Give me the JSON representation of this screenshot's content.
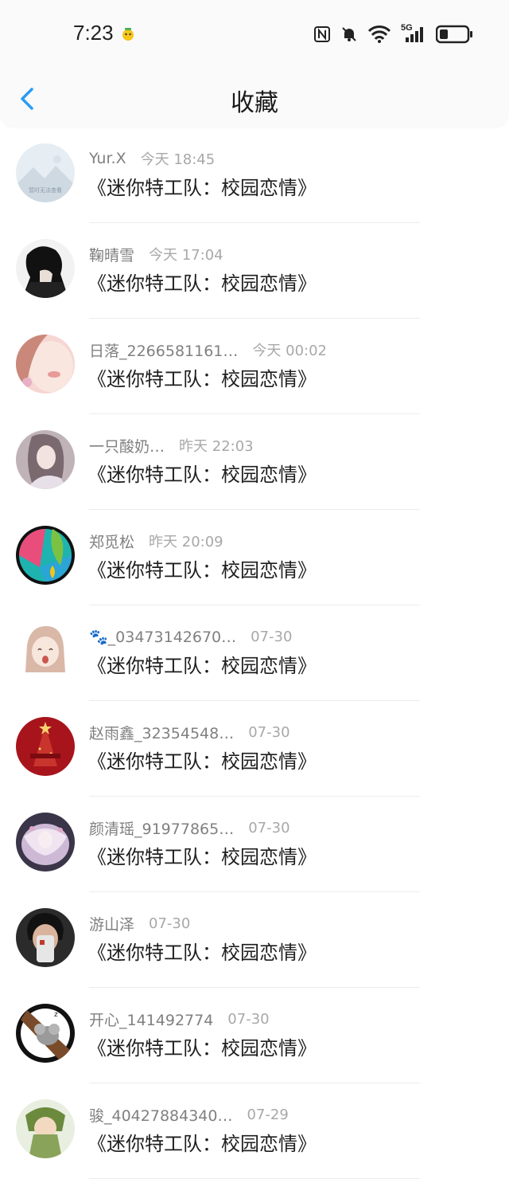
{
  "status_bar": {
    "time": "7:23",
    "network": "5G"
  },
  "header": {
    "title": "收藏"
  },
  "items": [
    {
      "name": "Yur.X",
      "time": "今天 18:45",
      "work": "《迷你特工队：校园恋情》",
      "avatar_caption": "暂时无法查看"
    },
    {
      "name": "鞠晴雪",
      "time": "今天 17:04",
      "work": "《迷你特工队：校园恋情》"
    },
    {
      "name": "日落_2266581161…",
      "time": "今天 00:02",
      "work": "《迷你特工队：校园恋情》"
    },
    {
      "name": "一只酸奶…",
      "time": "昨天 22:03",
      "work": "《迷你特工队：校园恋情》"
    },
    {
      "name": "郑觅松",
      "time": "昨天 20:09",
      "work": "《迷你特工队：校园恋情》"
    },
    {
      "name": "🐾_03473142670…",
      "time": "07-30",
      "work": "《迷你特工队：校园恋情》"
    },
    {
      "name": "赵雨鑫_32354548…",
      "time": "07-30",
      "work": "《迷你特工队：校园恋情》"
    },
    {
      "name": "颜清瑶_91977865…",
      "time": "07-30",
      "work": "《迷你特工队：校园恋情》"
    },
    {
      "name": "游山泽",
      "time": "07-30",
      "work": "《迷你特工队：校园恋情》"
    },
    {
      "name": "开心_141492774",
      "time": "07-30",
      "work": "《迷你特工队：校园恋情》"
    },
    {
      "name": "骏_40427884340…",
      "time": "07-29",
      "work": "《迷你特工队：校园恋情》"
    }
  ],
  "colors": {
    "accent": "#2a9df4",
    "name_text": "#808080",
    "time_text": "#a8a8a8"
  }
}
